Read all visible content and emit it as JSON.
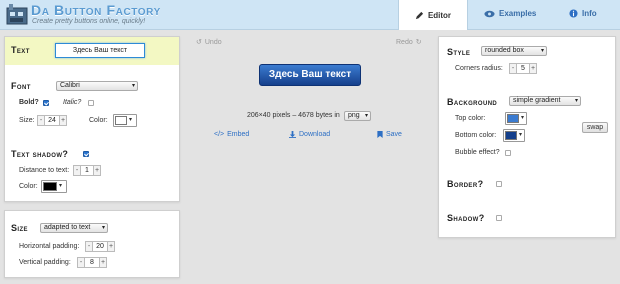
{
  "app": {
    "title": "Da Button Factory",
    "subtitle": "Create pretty buttons online, quickly!"
  },
  "nav": {
    "editor": "Editor",
    "examples": "Examples",
    "info": "Info"
  },
  "text_section": {
    "title": "Text",
    "value": "Здесь Ваш текст"
  },
  "font_section": {
    "title": "Font",
    "font": "Calibri",
    "bold_label": "Bold?",
    "italic_label": "Italic?",
    "size_label": "Size:",
    "size_value": "24",
    "color_label": "Color:",
    "color": "#ffffff"
  },
  "shadow_section": {
    "title": "Text shadow?",
    "distance_label": "Distance to text:",
    "distance_value": "1",
    "color_label": "Color:",
    "color": "#000000"
  },
  "size_section": {
    "title": "Size",
    "mode": "adapted to text",
    "hpad_label": "Horizontal padding:",
    "hpad_value": "20",
    "vpad_label": "Vertical padding:",
    "vpad_value": "8"
  },
  "preview": {
    "undo": "Undo",
    "redo": "Redo",
    "button_text": "Здесь Ваш текст",
    "info": "206×40 pixels – 4678 bytes in",
    "format": "png",
    "embed": "Embed",
    "download": "Download",
    "save": "Save"
  },
  "style_section": {
    "title": "Style",
    "style": "rounded box",
    "radius_label": "Corners radius:",
    "radius_value": "5"
  },
  "background_section": {
    "title": "Background",
    "mode": "simple gradient",
    "top_label": "Top color:",
    "top_color": "#3b7bd0",
    "bottom_label": "Bottom color:",
    "bottom_color": "#15408c",
    "swap": "swap",
    "bubble_label": "Bubble effect?"
  },
  "border_section": {
    "title": "Border?"
  },
  "box_shadow_section": {
    "title": "Shadow?"
  },
  "symbols": {
    "minus": "-",
    "plus": "+",
    "dropdown_arrow": "▾",
    "undo_glyph": "↺",
    "redo_glyph": "↻"
  },
  "colors": {
    "header_bg": "#cfe5f5",
    "accent": "#2d6fc4",
    "text_panel_bg": "#f3f8c3"
  }
}
